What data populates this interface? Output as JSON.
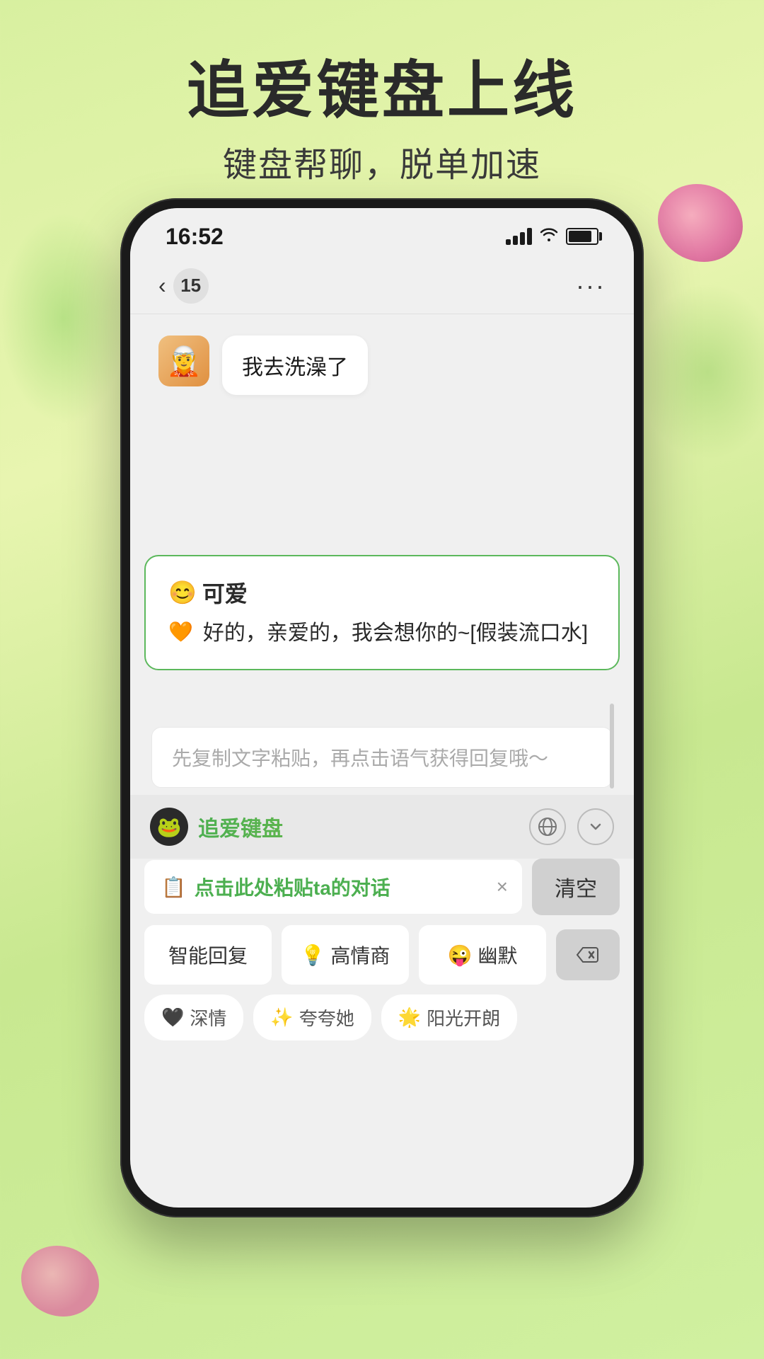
{
  "page": {
    "background": "light-green-gradient"
  },
  "header": {
    "main_title": "追爱键盘上线",
    "sub_title": "键盘帮聊，脱单加速"
  },
  "status_bar": {
    "time": "16:52",
    "signal": "signal-icon",
    "wifi": "wifi-icon",
    "battery": "battery-icon"
  },
  "nav": {
    "back_label": "‹",
    "badge_count": "15",
    "more_label": "···"
  },
  "chat": {
    "received_message": "我去洗澡了",
    "avatar_emoji": "🧝"
  },
  "ai_card": {
    "title_emoji": "😊",
    "title_text": "可爱",
    "copy_emoji": "🧡",
    "content": "好的，亲爱的，我会想你的~[假装流口水]"
  },
  "input": {
    "placeholder": "先复制文字粘贴，再点击语气获得回复哦～"
  },
  "keyboard": {
    "logo_emoji": "🐸",
    "name": "追爱键盘",
    "globe_icon": "⊕",
    "down_icon": "⌄",
    "paste_icon": "📋",
    "paste_text": "点击此处粘贴ta的对话",
    "paste_close": "×",
    "clear_label": "清空",
    "buttons": {
      "smart_reply": "智能回复",
      "high_eq_emoji": "💡",
      "high_eq": "高情商",
      "humor_emoji": "😜",
      "humor": "幽默",
      "delete_icon": "⌫"
    },
    "tags": {
      "deep_emoji": "🖤",
      "deep": "深情",
      "praise_emoji": "✨",
      "praise": "夸夸她",
      "sunshine_emoji": "🌟",
      "sunshine": "阳光开朗"
    }
  }
}
